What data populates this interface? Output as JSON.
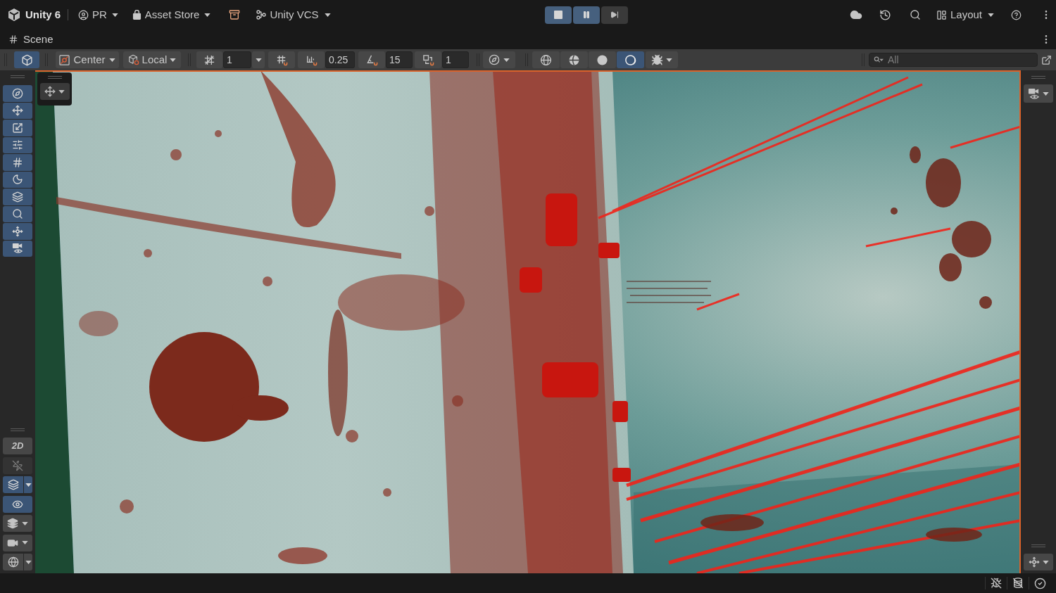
{
  "title_bar": {
    "product": "Unity 6",
    "account": "PR",
    "store": "Asset Store",
    "version_control": "Unity VCS",
    "layout": "Layout"
  },
  "play_controls": [
    {
      "kind": "stop",
      "on": true
    },
    {
      "kind": "pause",
      "on": true
    },
    {
      "kind": "step",
      "on": false
    }
  ],
  "panel": {
    "title": "Scene"
  },
  "scene_toolbar": {
    "view_toggle": {
      "on": true
    },
    "pivot": "Center",
    "space": "Local",
    "grid_size": "1",
    "increment_snap": "0.25",
    "rotation_snap": "15",
    "scale_snap": "1",
    "shading_modes": [
      {
        "kind": "wireframe",
        "selected": false
      },
      {
        "kind": "shaded_wireframe",
        "selected": false
      },
      {
        "kind": "unlit",
        "selected": false
      },
      {
        "kind": "lit",
        "selected": true
      }
    ],
    "search": {
      "placeholder": "All"
    }
  },
  "tools": [
    {
      "kind": "view",
      "selected": true
    },
    {
      "kind": "move",
      "selected": true
    },
    {
      "kind": "rect",
      "selected": true
    },
    {
      "kind": "transform",
      "selected": true
    },
    {
      "kind": "grid",
      "selected": true
    },
    {
      "kind": "shading",
      "selected": true
    },
    {
      "kind": "placement",
      "selected": true
    },
    {
      "kind": "zoom",
      "selected": true
    },
    {
      "kind": "pivot",
      "selected": true
    },
    {
      "kind": "camera",
      "selected": true
    }
  ],
  "scene_toggles": [
    {
      "kind": "flat",
      "label": "2D",
      "on": false,
      "disabled": false
    },
    {
      "kind": "lighting",
      "on": false,
      "disabled": true
    },
    {
      "kind": "effects",
      "on": true,
      "disabled": false
    },
    {
      "kind": "visibility",
      "on": true,
      "disabled": false
    },
    {
      "kind": "layers",
      "on": false,
      "disabled": false
    },
    {
      "kind": "camera",
      "on": false,
      "disabled": false
    },
    {
      "kind": "gizmos",
      "on": false,
      "disabled": false
    }
  ]
}
